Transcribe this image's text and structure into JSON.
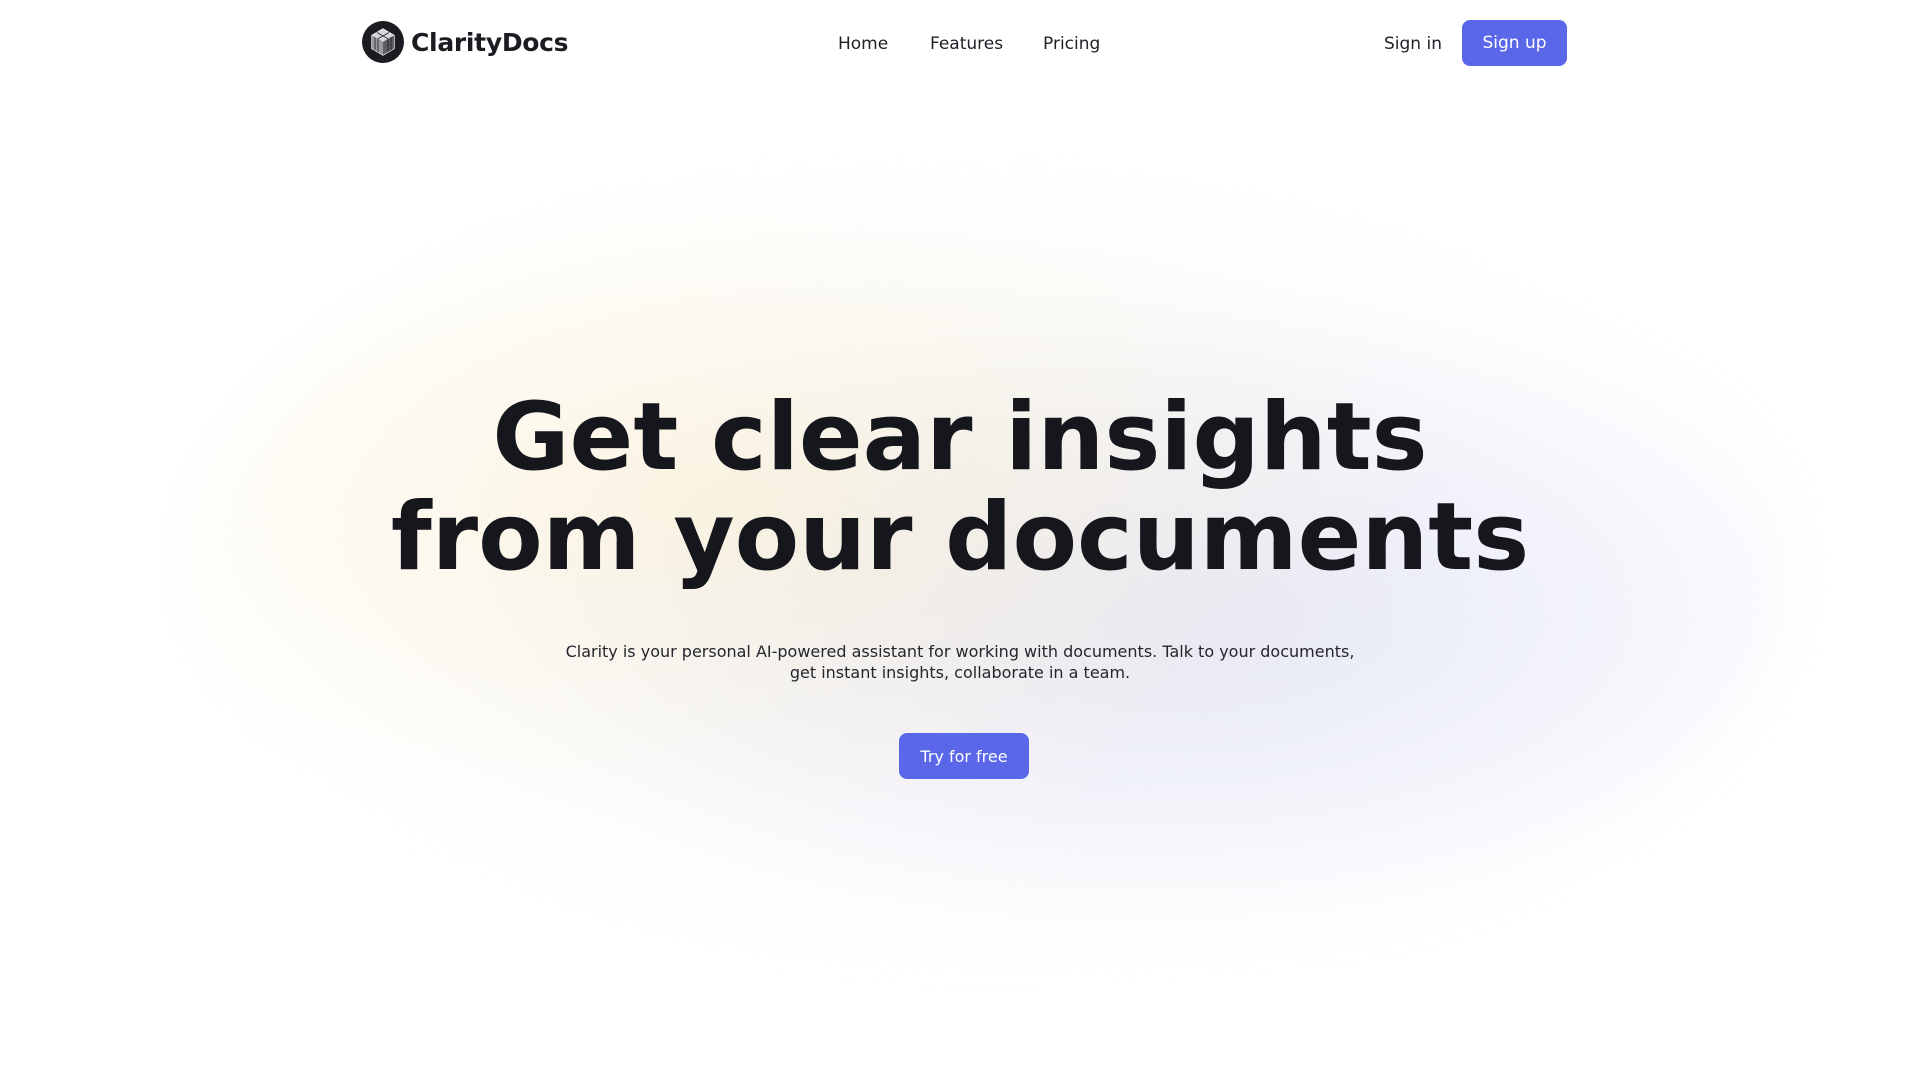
{
  "header": {
    "logo_text": "ClarityDocs",
    "nav": {
      "home": "Home",
      "features": "Features",
      "pricing": "Pricing"
    },
    "sign_in": "Sign in",
    "sign_up": "Sign up"
  },
  "hero": {
    "title_line_1": "Get clear insights",
    "title_line_2": "from your documents",
    "subtitle": "Clarity is your personal AI-powered assistant for working with documents. Talk to your documents, get instant insights, collaborate in a team.",
    "cta": "Try for free"
  },
  "icons": {
    "logo": "hexagon-cube-logo-icon"
  },
  "colors": {
    "accent": "#5a67e8",
    "text": "#16161d",
    "background": "#ffffff"
  }
}
